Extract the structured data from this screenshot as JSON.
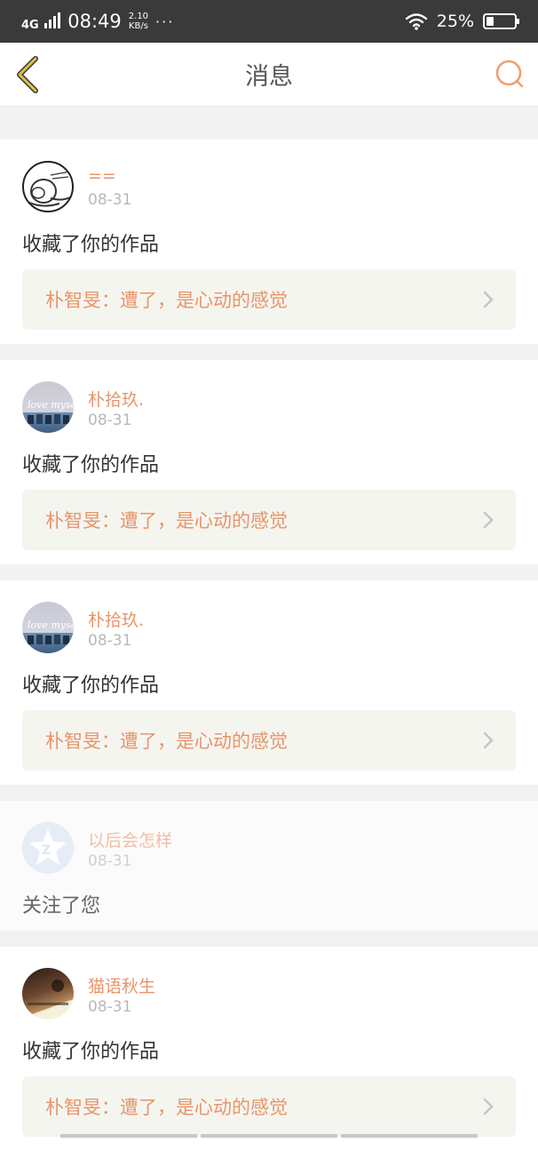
{
  "status_bar": {
    "network": "4G",
    "time": "08:49",
    "speed_value": "2.10",
    "speed_unit": "KB/s",
    "more": "···",
    "battery_percent": "25%",
    "battery_level": 0.25
  },
  "nav": {
    "title": "消息",
    "back_icon": "chevron-left-icon",
    "search_icon": "search-icon"
  },
  "notifications": [
    {
      "user": "==",
      "date": "08-31",
      "action": "收藏了你的作品",
      "work_title": "朴智旻：遭了，是心动的感觉",
      "avatar": "sketch-avatar"
    },
    {
      "user": "朴拾玖.",
      "date": "08-31",
      "action": "收藏了你的作品",
      "work_title": "朴智旻：遭了，是心动的感觉",
      "avatar": "love-myself-avatar"
    },
    {
      "user": "朴拾玖.",
      "date": "08-31",
      "action": "收藏了你的作品",
      "work_title": "朴智旻：遭了，是心动的感觉",
      "avatar": "love-myself-avatar"
    },
    {
      "user": "以后会怎样",
      "date": "08-31",
      "action": "关注了您",
      "work_title": "",
      "avatar": "default-star-avatar"
    },
    {
      "user": "猫语秋生",
      "date": "08-31",
      "action": "收藏了你的作品",
      "work_title": "朴智旻：遭了，是心动的感觉",
      "avatar": "photo-avatar"
    }
  ],
  "colors": {
    "accent": "#e8956a",
    "work_bg": "#f5f5ef",
    "status_bg": "#3a3a3a"
  }
}
